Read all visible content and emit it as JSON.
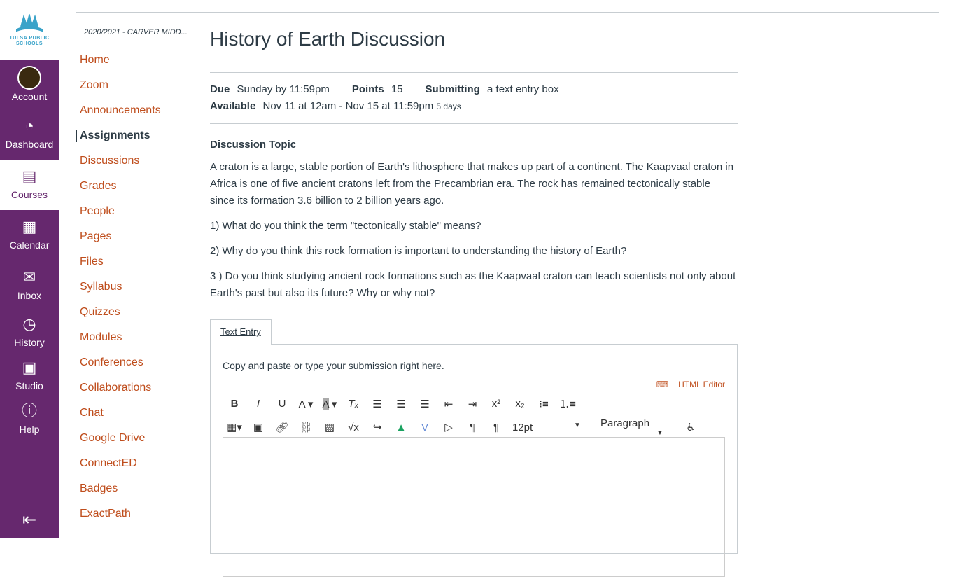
{
  "logo": {
    "text": "TULSA PUBLIC SCHOOLS"
  },
  "global_nav": [
    {
      "label": "Account",
      "icon": "avatar"
    },
    {
      "label": "Dashboard",
      "icon": "dashboard-icon"
    },
    {
      "label": "Courses",
      "icon": "courses-icon"
    },
    {
      "label": "Calendar",
      "icon": "calendar-icon"
    },
    {
      "label": "Inbox",
      "icon": "inbox-icon"
    },
    {
      "label": "History",
      "icon": "history-icon"
    },
    {
      "label": "Studio",
      "icon": "studio-icon"
    },
    {
      "label": "Help",
      "icon": "help-icon"
    }
  ],
  "breadcrumb": "2020/2021 - CARVER MIDD...",
  "course_nav": [
    "Home",
    "Zoom",
    "Announcements",
    "Assignments",
    "Discussions",
    "Grades",
    "People",
    "Pages",
    "Files",
    "Syllabus",
    "Quizzes",
    "Modules",
    "Conferences",
    "Collaborations",
    "Chat",
    "Google Drive",
    "ConnectED",
    "Badges",
    "ExactPath"
  ],
  "title": "History of Earth Discussion",
  "meta": {
    "due_label": "Due",
    "due": "Sunday by 11:59pm",
    "points_label": "Points",
    "points": "15",
    "submitting_label": "Submitting",
    "submitting": "a text entry box",
    "available_label": "Available",
    "available": "Nov 11 at 12am - Nov 15 at 11:59pm",
    "duration": "5 days"
  },
  "topic": {
    "heading": "Discussion Topic",
    "paragraphs": [
      "A craton is a large, stable portion of Earth's lithosphere that makes up part of a continent. The Kaapvaal craton in Africa is one of five ancient cratons left from the Precambrian era. The rock has remained tectonically stable since its formation 3.6 billion to 2 billion years ago.",
      "1) What do you think the term \"tectonically stable\" means?",
      "2) Why do you think this rock formation is important to understanding the history of Earth?",
      "3 ) Do you think studying ancient rock formations such as the Kaapvaal craton can teach scientists not only about Earth's past but also its future?  Why or why not?"
    ]
  },
  "submission": {
    "tab": "Text Entry",
    "intro": "Copy and paste or type your submission right here.",
    "html_editor": "HTML Editor",
    "font_size": "12pt",
    "format": "Paragraph"
  }
}
